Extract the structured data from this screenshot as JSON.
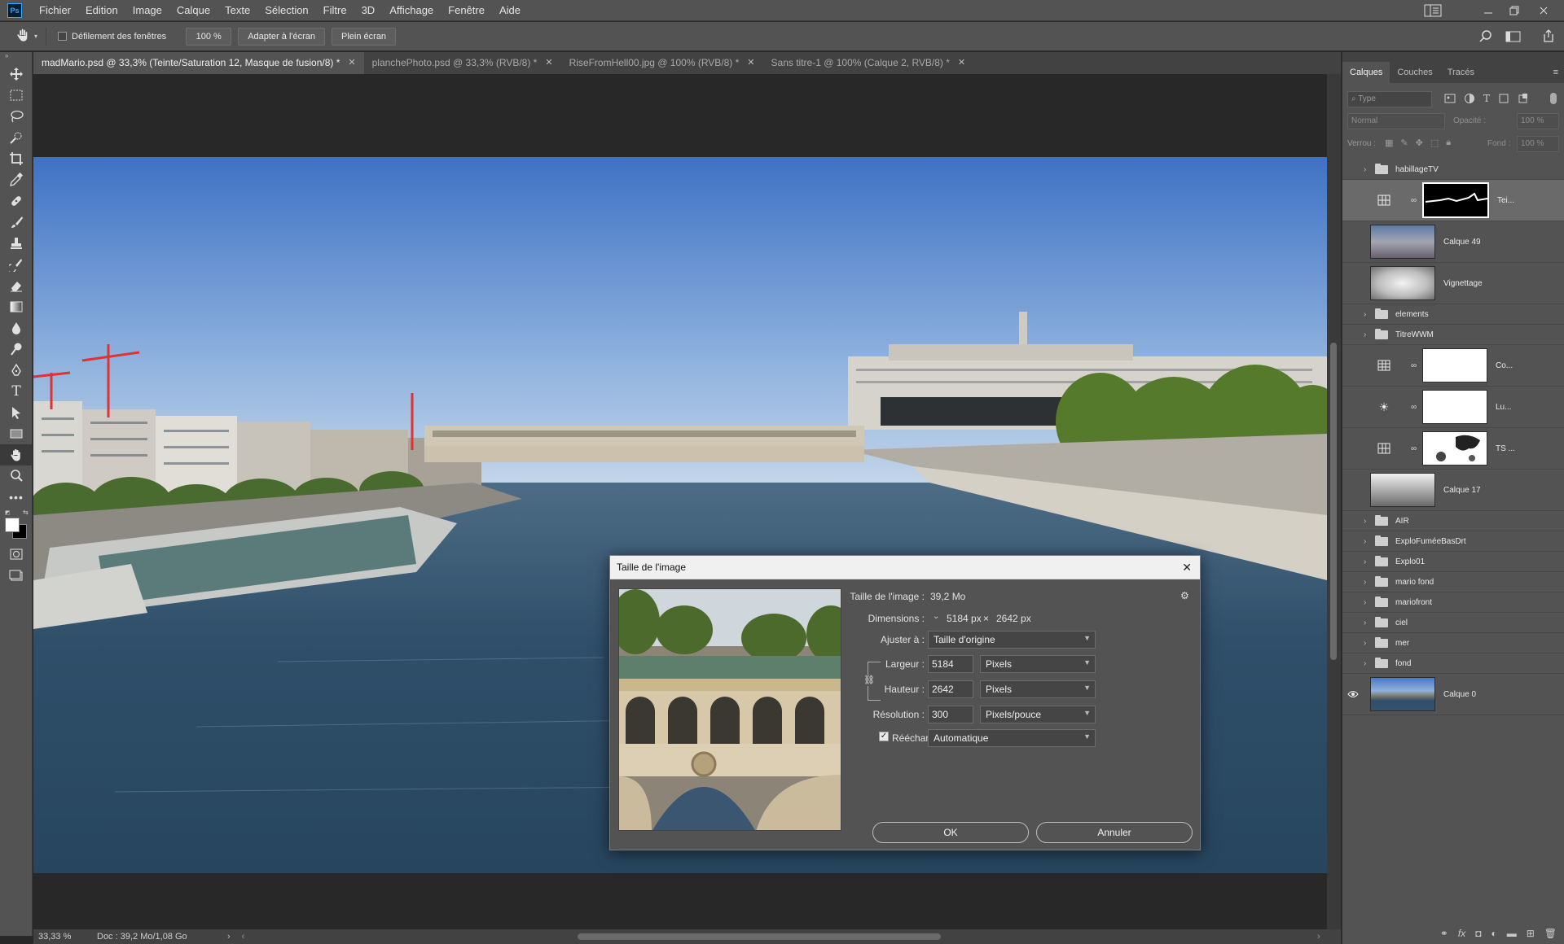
{
  "menubar": {
    "app_badge": "Ps",
    "items": [
      "Fichier",
      "Edition",
      "Image",
      "Calque",
      "Texte",
      "Sélection",
      "Filtre",
      "3D",
      "Affichage",
      "Fenêtre",
      "Aide"
    ]
  },
  "options": {
    "scroll_all_windows": "Défilement des fenêtres",
    "zoom_value": "100 %",
    "fit_screen": "Adapter à l'écran",
    "fill_screen": "Plein écran"
  },
  "tabs": [
    {
      "label": "madMario.psd @ 33,3% (Teinte/Saturation 12, Masque de fusion/8) *",
      "active": true
    },
    {
      "label": "planchePhoto.psd @ 33,3% (RVB/8) *",
      "active": false
    },
    {
      "label": "RiseFromHell00.jpg @ 100% (RVB/8) *",
      "active": false
    },
    {
      "label": "Sans titre-1 @ 100% (Calque 2, RVB/8) *",
      "active": false
    }
  ],
  "status": {
    "zoom": "33,33 %",
    "doc": "Doc : 39,2 Mo/1,08 Go"
  },
  "panel": {
    "tabs": [
      "Calques",
      "Couches",
      "Tracés"
    ],
    "filter_placeholder": "Type",
    "blend_mode": "Normal",
    "opacity_label": "Opacité :",
    "opacity_value": "100 %",
    "lock_label": "Verrou :",
    "fill_label": "Fond :",
    "fill_value": "100 %",
    "layers": [
      {
        "name": "habillageTV",
        "kind": "group"
      },
      {
        "name": "Tei...",
        "kind": "adjust-mask"
      },
      {
        "name": "Calque 49",
        "kind": "photo"
      },
      {
        "name": "Vignettage",
        "kind": "vignette"
      },
      {
        "name": "elements",
        "kind": "group"
      },
      {
        "name": "TitreWWM",
        "kind": "group"
      },
      {
        "name": "Co...",
        "kind": "adjust-white"
      },
      {
        "name": "Lu...",
        "kind": "adjust-bright"
      },
      {
        "name": "TS ...",
        "kind": "adjust-mask2"
      },
      {
        "name": "Calque 17",
        "kind": "gradient"
      },
      {
        "name": "AIR",
        "kind": "group"
      },
      {
        "name": "ExploFuméeBasDrt",
        "kind": "group"
      },
      {
        "name": "Explo01",
        "kind": "group"
      },
      {
        "name": "mario fond",
        "kind": "group"
      },
      {
        "name": "mariofront",
        "kind": "group"
      },
      {
        "name": "ciel",
        "kind": "group"
      },
      {
        "name": "mer",
        "kind": "group"
      },
      {
        "name": "fond",
        "kind": "group"
      },
      {
        "name": "Calque 0",
        "kind": "base"
      }
    ]
  },
  "dialog": {
    "title": "Taille de l'image",
    "size_label": "Taille de l'image :",
    "size_value": "39,2 Mo",
    "dimensions_label": "Dimensions :",
    "dim_width": "5184 px",
    "dim_times": "×",
    "dim_height": "2642 px",
    "fit_label": "Ajuster à :",
    "fit_value": "Taille d'origine",
    "width_label": "Largeur :",
    "width_value": "5184",
    "width_unit": "Pixels",
    "height_label": "Hauteur :",
    "height_value": "2642",
    "height_unit": "Pixels",
    "resolution_label": "Résolution :",
    "resolution_value": "300",
    "resolution_unit": "Pixels/pouce",
    "resample_label": "Rééchantillonnage :",
    "resample_value": "Automatique",
    "resample_checked": true,
    "ok": "OK",
    "cancel": "Annuler"
  }
}
